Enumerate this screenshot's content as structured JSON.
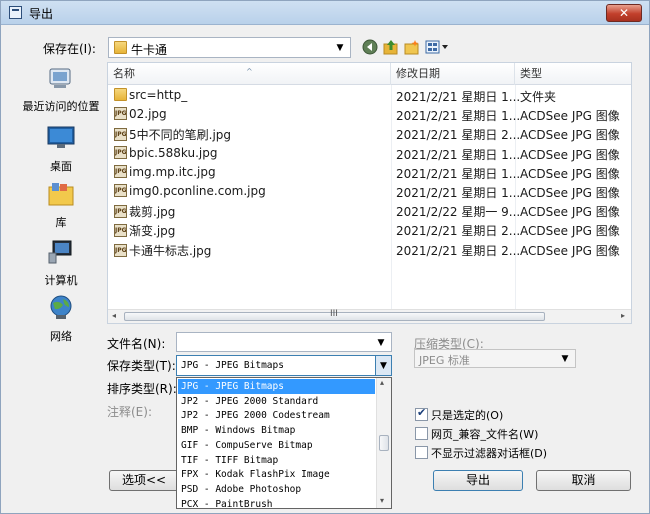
{
  "window": {
    "title": "导出",
    "close_glyph": "✕"
  },
  "location": {
    "label": "保存在(I):",
    "value": "牛卡通",
    "icons": [
      "back-icon",
      "up-folder-icon",
      "new-folder-icon",
      "view-menu-icon"
    ]
  },
  "places": [
    {
      "label": "最近访问的位置",
      "icon": "recent-places-icon"
    },
    {
      "label": "桌面",
      "icon": "desktop-icon"
    },
    {
      "label": "库",
      "icon": "libraries-icon"
    },
    {
      "label": "计算机",
      "icon": "computer-icon"
    },
    {
      "label": "网络",
      "icon": "network-icon"
    }
  ],
  "list": {
    "columns": [
      "名称",
      "修改日期",
      "类型"
    ],
    "sort_glyph": "^",
    "rows": [
      {
        "name": "src=http_",
        "date": "2021/2/21 星期日 1...",
        "type": "文件夹",
        "icon": "folder-icon"
      },
      {
        "name": "02.jpg",
        "date": "2021/2/21 星期日 1...",
        "type": "ACDSee JPG 图像",
        "icon": "jpg-file-icon"
      },
      {
        "name": "5中不同的笔刷.jpg",
        "date": "2021/2/21 星期日 2...",
        "type": "ACDSee JPG 图像",
        "icon": "jpg-file-icon"
      },
      {
        "name": "bpic.588ku.jpg",
        "date": "2021/2/21 星期日 1...",
        "type": "ACDSee JPG 图像",
        "icon": "jpg-file-icon"
      },
      {
        "name": "img.mp.itc.jpg",
        "date": "2021/2/21 星期日 1...",
        "type": "ACDSee JPG 图像",
        "icon": "jpg-file-icon"
      },
      {
        "name": "img0.pconline.com.jpg",
        "date": "2021/2/21 星期日 1...",
        "type": "ACDSee JPG 图像",
        "icon": "jpg-file-icon"
      },
      {
        "name": "裁剪.jpg",
        "date": "2021/2/22 星期一 9...",
        "type": "ACDSee JPG 图像",
        "icon": "jpg-file-icon"
      },
      {
        "name": "渐变.jpg",
        "date": "2021/2/21 星期日 2...",
        "type": "ACDSee JPG 图像",
        "icon": "jpg-file-icon"
      },
      {
        "name": "卡通牛标志.jpg",
        "date": "2021/2/21 星期日 2...",
        "type": "ACDSee JPG 图像",
        "icon": "jpg-file-icon"
      }
    ],
    "jpg_badge": "JPG",
    "scroll_grip": "III",
    "scroll_left": "◂",
    "scroll_right": "▸"
  },
  "form": {
    "filename_label": "文件名(N):",
    "filename_value": "",
    "savetype_label": "保存类型(T):",
    "savetype_value": "JPG - JPEG Bitmaps",
    "sorttype_label": "排序类型(R):",
    "note_label": "注释(E):",
    "compress_label": "压缩类型(C):",
    "compress_value": "JPEG 标准"
  },
  "dropdown": {
    "options": [
      "JPG - JPEG Bitmaps",
      "JP2 - JPEG 2000 Standard",
      "JP2 - JPEG 2000 Codestream",
      "BMP - Windows Bitmap",
      "GIF - CompuServe Bitmap",
      "TIF - TIFF Bitmap",
      "FPX - Kodak FlashPix Image",
      "PSD - Adobe Photoshop",
      "PCX - PaintBrush"
    ],
    "selected_index": 0,
    "up": "▴",
    "down": "▾"
  },
  "checks": [
    {
      "label": "只是选定的(O)",
      "checked": true
    },
    {
      "label": "网页_兼容_文件名(W)",
      "checked": false
    },
    {
      "label": "不显示过滤器对话框(D)",
      "checked": false
    }
  ],
  "buttons": {
    "options": "选项<<",
    "export": "导出",
    "cancel": "取消"
  },
  "colors": {
    "selection": "#3399ff",
    "title_gradient_top": "#cfe0f2",
    "close_red": "#c2402c"
  }
}
